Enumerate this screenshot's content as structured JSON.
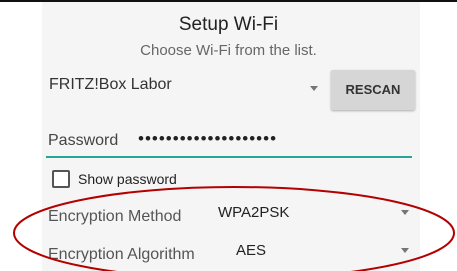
{
  "dialog": {
    "title": "Setup Wi-Fi",
    "subtitle": "Choose Wi-Fi from the list."
  },
  "network": {
    "selected_ssid": "FRITZ!Box Labor",
    "rescan_label": "RESCAN"
  },
  "password": {
    "label": "Password",
    "masked_value": "••••••••••••••••••••"
  },
  "show_password": {
    "label": "Show password",
    "checked": false
  },
  "encryption": {
    "method_label": "Encryption Method",
    "method_value": "WPA2PSK",
    "algorithm_label": "Encryption Algorithm",
    "algorithm_value": "AES"
  },
  "colors": {
    "accent_underline": "#26a69a",
    "annotation": "#b30000",
    "panel_background": "#f5f5f5"
  },
  "icons": {
    "dropdown": "chevron-down-icon"
  }
}
